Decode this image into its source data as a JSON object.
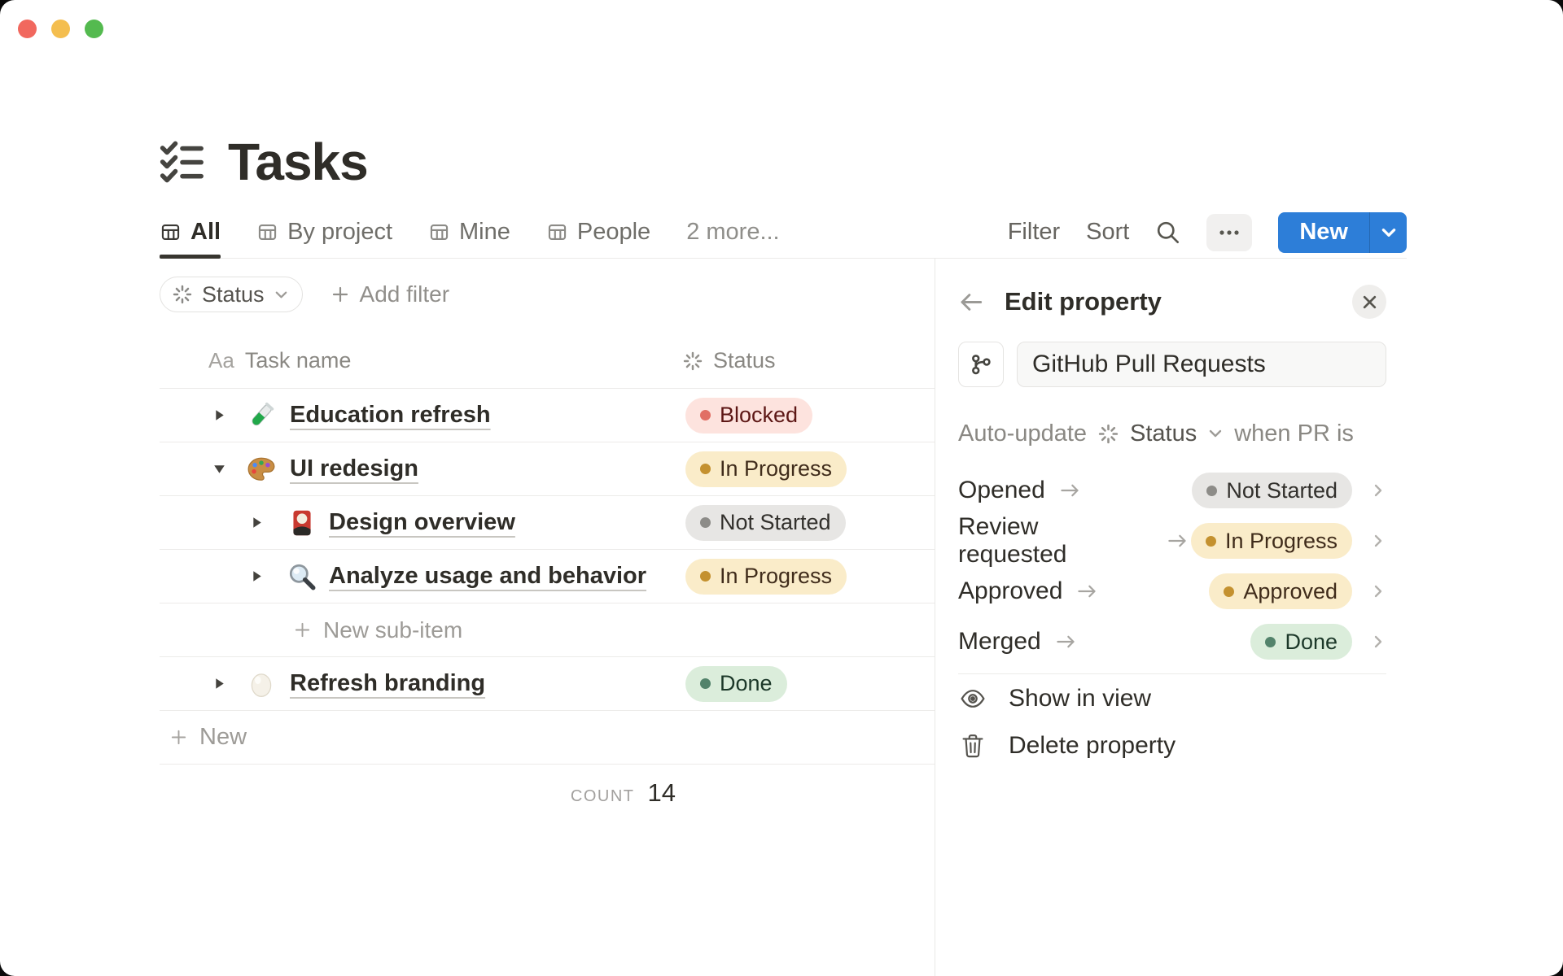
{
  "page": {
    "title": "Tasks",
    "tabs": [
      {
        "label": "All",
        "active": true
      },
      {
        "label": "By project",
        "active": false
      },
      {
        "label": "Mine",
        "active": false
      },
      {
        "label": "People",
        "active": false
      },
      {
        "label": "2 more...",
        "active": false
      }
    ],
    "toolbar": {
      "filter": "Filter",
      "sort": "Sort",
      "new_label": "New"
    },
    "filter_bar": {
      "status_filter": "Status",
      "add_filter": "Add filter"
    },
    "table": {
      "columns": {
        "name_icon": "Aa",
        "name": "Task name",
        "status": "Status"
      },
      "rows": [
        {
          "title": "Education refresh",
          "emoji": "test-tube",
          "level": 0,
          "expanded": false,
          "status": "Blocked",
          "status_color": "red"
        },
        {
          "title": "UI redesign",
          "emoji": "palette",
          "level": 0,
          "expanded": true,
          "status": "In Progress",
          "status_color": "yellow"
        },
        {
          "title": "Design overview",
          "emoji": "flower-card",
          "level": 1,
          "expanded": false,
          "status": "Not Started",
          "status_color": "gray"
        },
        {
          "title": "Analyze usage and behavior",
          "emoji": "magnifier",
          "level": 1,
          "expanded": false,
          "status": "In Progress",
          "status_color": "yellow"
        },
        {
          "title": "Refresh branding",
          "emoji": "egg",
          "level": 0,
          "expanded": false,
          "status": "Done",
          "status_color": "green"
        }
      ],
      "new_sub_item_label": "New sub-item",
      "new_row_label": "New",
      "count_label": "COUNT",
      "count_value": "14"
    }
  },
  "panel": {
    "title": "Edit property",
    "property_name": "GitHub Pull Requests",
    "auto_update": {
      "prefix": "Auto-update",
      "property": "Status",
      "suffix": "when PR is"
    },
    "mappings": [
      {
        "trigger": "Opened",
        "status": "Not Started",
        "color": "gray"
      },
      {
        "trigger": "Review requested",
        "status": "In Progress",
        "color": "yellow"
      },
      {
        "trigger": "Approved",
        "status": "Approved",
        "color": "yellow"
      },
      {
        "trigger": "Merged",
        "status": "Done",
        "color": "green"
      }
    ],
    "actions": {
      "show_in_view": "Show in view",
      "delete_property": "Delete property"
    }
  },
  "colors": {
    "accent_blue": "#2D7ED8",
    "badge_red_bg": "#FDE3DE",
    "badge_yellow_bg": "#FAECC9",
    "badge_gray_bg": "#E7E6E4",
    "badge_green_bg": "#DBEDDB",
    "traffic_red": "#F1685E",
    "traffic_yellow": "#F4BE4F",
    "traffic_green": "#54BA4F"
  }
}
